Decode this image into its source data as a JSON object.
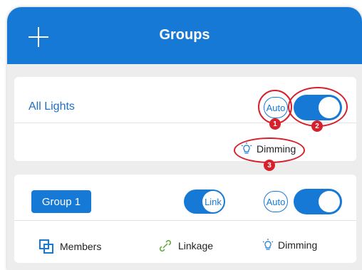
{
  "header": {
    "title": "Groups",
    "add_icon": "plus-icon"
  },
  "all_lights": {
    "label": "All Lights",
    "auto_label": "Auto",
    "dimming_label": "Dimming",
    "annotations": [
      "1",
      "2",
      "3"
    ]
  },
  "group1": {
    "name": "Group 1",
    "link_label": "Link",
    "auto_label": "Auto",
    "footer": {
      "members_label": "Members",
      "linkage_label": "Linkage",
      "dimming_label": "Dimming"
    }
  },
  "colors": {
    "accent": "#1779d6",
    "annotation": "#d6212d",
    "background": "#ededed"
  }
}
